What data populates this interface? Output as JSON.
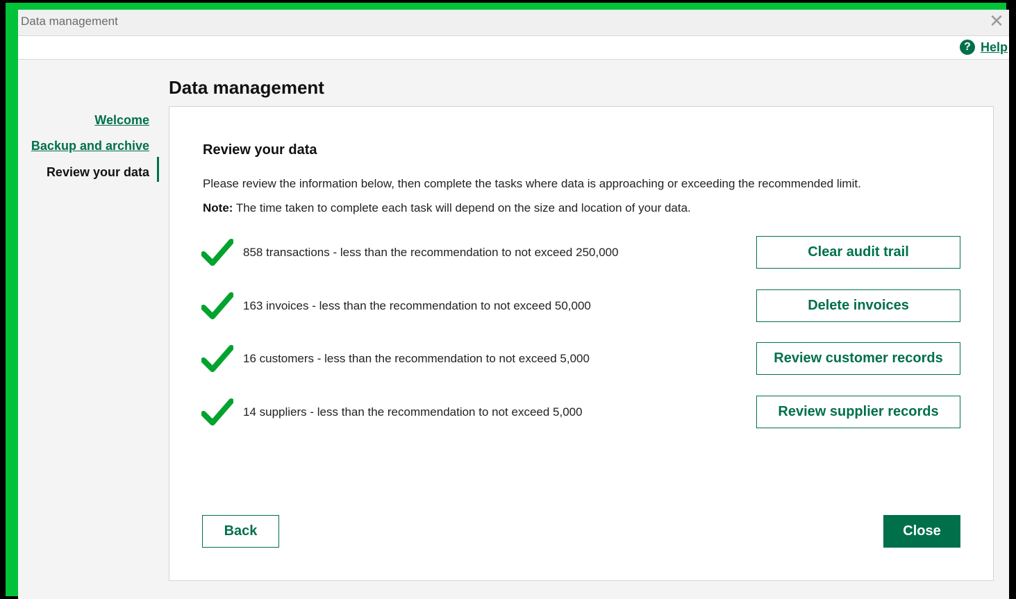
{
  "window": {
    "title": "Data management",
    "close_glyph": "✕"
  },
  "help": {
    "icon_glyph": "?",
    "label": "Help"
  },
  "page_title": "Data management",
  "sidebar": {
    "items": [
      {
        "label": "Welcome",
        "state": "link"
      },
      {
        "label": "Backup and archive",
        "state": "link"
      },
      {
        "label": "Review your data",
        "state": "current"
      }
    ]
  },
  "content": {
    "section_title": "Review your data",
    "intro": "Please review the information below, then complete the tasks where data is approaching or exceeding the recommended limit.",
    "note_label": "Note:",
    "note_text": " The time taken to complete each task will depend on the size and location of your data.",
    "rows": [
      {
        "icon": "check-icon",
        "text": "858 transactions - less than the recommendation to not exceed 250,000",
        "button": "Clear audit trail"
      },
      {
        "icon": "check-icon",
        "text": "163 invoices - less than the recommendation to not exceed 50,000",
        "button": "Delete invoices"
      },
      {
        "icon": "check-icon",
        "text": "16 customers - less than the recommendation to not exceed 5,000",
        "button": "Review customer records"
      },
      {
        "icon": "check-icon",
        "text": "14 suppliers - less than the recommendation to not exceed 5,000",
        "button": "Review supplier records"
      }
    ]
  },
  "footer": {
    "back_label": "Back",
    "close_label": "Close"
  },
  "colors": {
    "brand_green": "#00704a",
    "check_green": "#00a32e",
    "outer_frame": "#00c33a"
  }
}
